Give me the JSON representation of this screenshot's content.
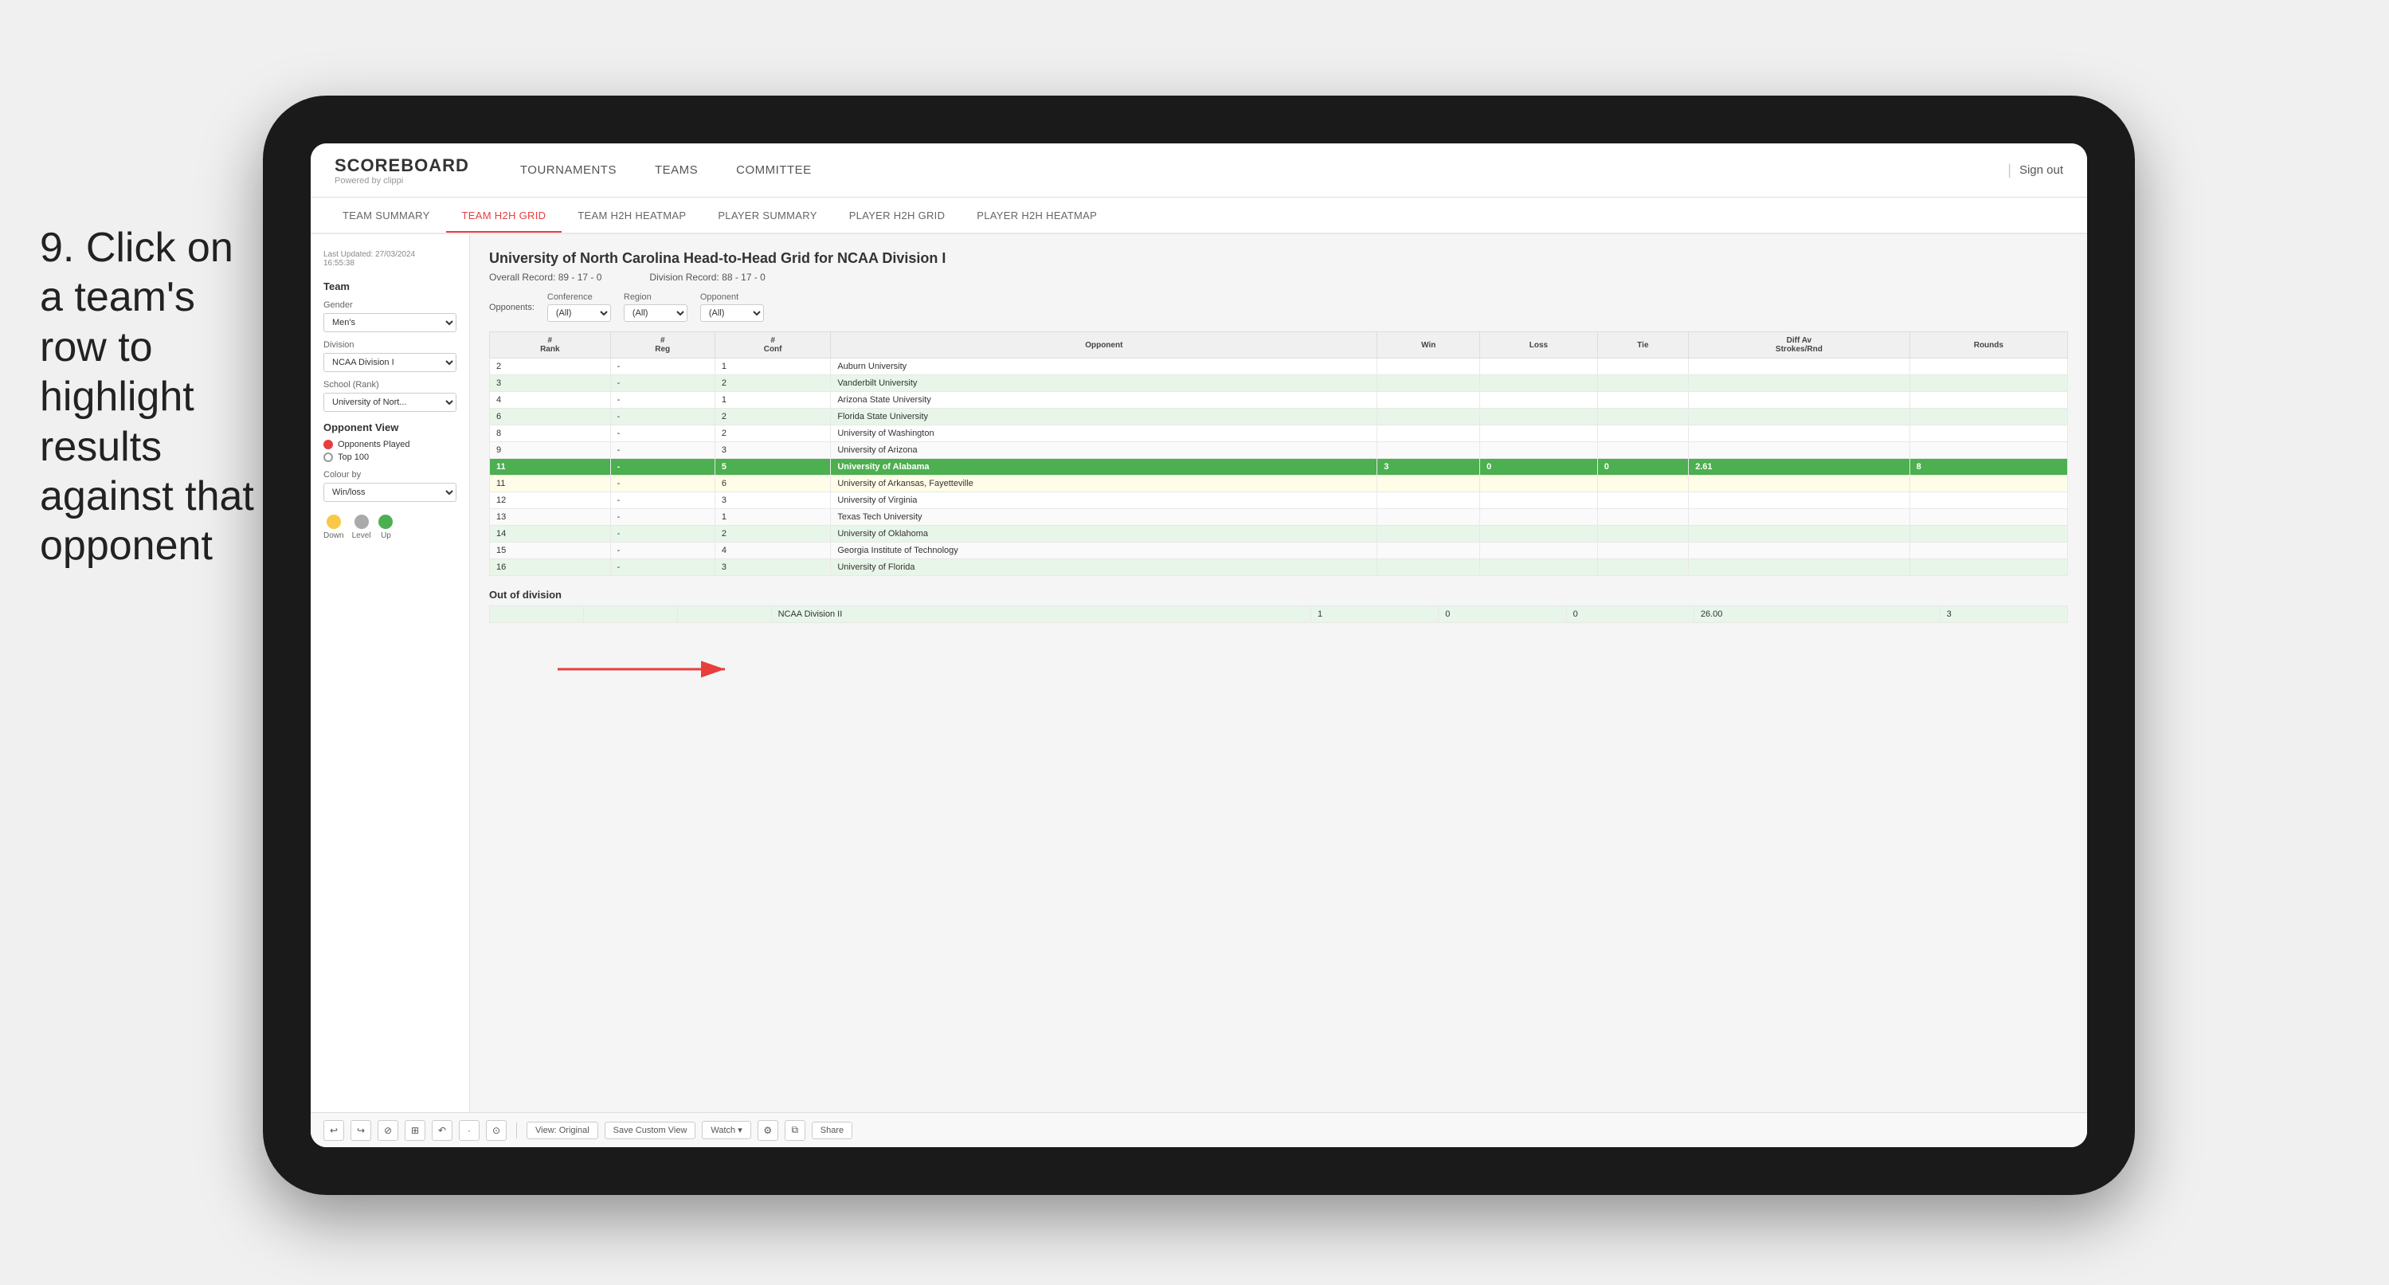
{
  "instruction": {
    "step": "9.",
    "text": "Click on a team's row to highlight results against that opponent"
  },
  "nav": {
    "logo": "SCOREBOARD",
    "logo_sub": "Powered by clippi",
    "items": [
      "TOURNAMENTS",
      "TEAMS",
      "COMMITTEE"
    ],
    "sign_out": "Sign out"
  },
  "sub_nav": {
    "items": [
      "TEAM SUMMARY",
      "TEAM H2H GRID",
      "TEAM H2H HEATMAP",
      "PLAYER SUMMARY",
      "PLAYER H2H GRID",
      "PLAYER H2H HEATMAP"
    ],
    "active": "TEAM H2H GRID"
  },
  "sidebar": {
    "timestamp_label": "Last Updated: 27/03/2024",
    "timestamp_time": "16:55:38",
    "team_label": "Team",
    "gender_label": "Gender",
    "gender_value": "Men's",
    "division_label": "Division",
    "division_value": "NCAA Division I",
    "school_label": "School (Rank)",
    "school_value": "University of Nort...",
    "opponent_view_label": "Opponent View",
    "opponents_played": "Opponents Played",
    "top_100": "Top 100",
    "colour_by_label": "Colour by",
    "colour_by_value": "Win/loss",
    "legend": [
      {
        "label": "Down",
        "color": "#f9c846"
      },
      {
        "label": "Level",
        "color": "#aaa"
      },
      {
        "label": "Up",
        "color": "#4caf50"
      }
    ]
  },
  "grid": {
    "title": "University of North Carolina Head-to-Head Grid for NCAA Division I",
    "overall_record_label": "Overall Record:",
    "overall_record": "89 - 17 - 0",
    "division_record_label": "Division Record:",
    "division_record": "88 - 17 - 0",
    "filters": {
      "opponents_label": "Opponents:",
      "conference_label": "Conference",
      "conference_value": "(All)",
      "region_label": "Region",
      "region_value": "(All)",
      "opponent_label": "Opponent",
      "opponent_value": "(All)"
    },
    "table_headers": [
      "#\nRank",
      "#\nReg",
      "#\nConf",
      "Opponent",
      "Win",
      "Loss",
      "Tie",
      "Diff Av\nStrokes/Rnd",
      "Rounds"
    ],
    "rows": [
      {
        "rank": "2",
        "reg": "-",
        "conf": "1",
        "opponent": "Auburn University",
        "win": "",
        "loss": "",
        "tie": "",
        "diff": "",
        "rounds": "",
        "style": "normal"
      },
      {
        "rank": "3",
        "reg": "-",
        "conf": "2",
        "opponent": "Vanderbilt University",
        "win": "",
        "loss": "",
        "tie": "",
        "diff": "",
        "rounds": "",
        "style": "light-green"
      },
      {
        "rank": "4",
        "reg": "-",
        "conf": "1",
        "opponent": "Arizona State University",
        "win": "",
        "loss": "",
        "tie": "",
        "diff": "",
        "rounds": "",
        "style": "normal"
      },
      {
        "rank": "6",
        "reg": "-",
        "conf": "2",
        "opponent": "Florida State University",
        "win": "",
        "loss": "",
        "tie": "",
        "diff": "",
        "rounds": "",
        "style": "light-green"
      },
      {
        "rank": "8",
        "reg": "-",
        "conf": "2",
        "opponent": "University of Washington",
        "win": "",
        "loss": "",
        "tie": "",
        "diff": "",
        "rounds": "",
        "style": "normal"
      },
      {
        "rank": "9",
        "reg": "-",
        "conf": "3",
        "opponent": "University of Arizona",
        "win": "",
        "loss": "",
        "tie": "",
        "diff": "",
        "rounds": "",
        "style": "normal"
      },
      {
        "rank": "11",
        "reg": "-",
        "conf": "5",
        "opponent": "University of Alabama",
        "win": "3",
        "loss": "0",
        "tie": "0",
        "diff": "2.61",
        "rounds": "8",
        "style": "highlighted"
      },
      {
        "rank": "11",
        "reg": "-",
        "conf": "6",
        "opponent": "University of Arkansas, Fayetteville",
        "win": "",
        "loss": "",
        "tie": "",
        "diff": "",
        "rounds": "",
        "style": "light-yellow"
      },
      {
        "rank": "12",
        "reg": "-",
        "conf": "3",
        "opponent": "University of Virginia",
        "win": "",
        "loss": "",
        "tie": "",
        "diff": "",
        "rounds": "",
        "style": "normal"
      },
      {
        "rank": "13",
        "reg": "-",
        "conf": "1",
        "opponent": "Texas Tech University",
        "win": "",
        "loss": "",
        "tie": "",
        "diff": "",
        "rounds": "",
        "style": "normal"
      },
      {
        "rank": "14",
        "reg": "-",
        "conf": "2",
        "opponent": "University of Oklahoma",
        "win": "",
        "loss": "",
        "tie": "",
        "diff": "",
        "rounds": "",
        "style": "light-green"
      },
      {
        "rank": "15",
        "reg": "-",
        "conf": "4",
        "opponent": "Georgia Institute of Technology",
        "win": "",
        "loss": "",
        "tie": "",
        "diff": "",
        "rounds": "",
        "style": "normal"
      },
      {
        "rank": "16",
        "reg": "-",
        "conf": "3",
        "opponent": "University of Florida",
        "win": "",
        "loss": "",
        "tie": "",
        "diff": "",
        "rounds": "",
        "style": "light-green"
      }
    ],
    "out_of_division_label": "Out of division",
    "out_of_division_row": {
      "opponent": "NCAA Division II",
      "win": "1",
      "loss": "0",
      "tie": "0",
      "diff": "26.00",
      "rounds": "3"
    }
  },
  "toolbar": {
    "buttons": [
      "↩",
      "↪",
      "⊘",
      "⊞",
      "↶",
      "·",
      "⊙"
    ],
    "view_label": "View: Original",
    "save_label": "Save Custom View",
    "watch_label": "Watch ▾",
    "share_label": "Share"
  },
  "colors": {
    "active_tab": "#e83e3e",
    "highlighted_row": "#4caf50",
    "light_green": "#e8f5e9",
    "light_yellow": "#fffde7",
    "down_legend": "#f9c846",
    "level_legend": "#aaa",
    "up_legend": "#4caf50"
  }
}
